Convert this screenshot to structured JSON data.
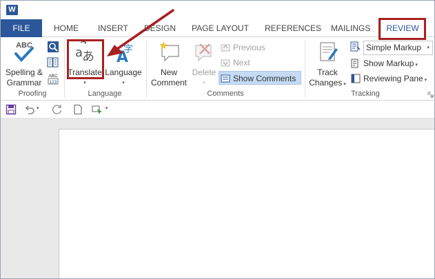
{
  "window": {
    "app_icon": "word-icon",
    "app_icon_letter": "W"
  },
  "tabs": {
    "file": "FILE",
    "home": "HOME",
    "insert": "INSERT",
    "design": "DESIGN",
    "page_layout": "PAGE LAYOUT",
    "references": "REFERENCES",
    "mailings": "MAILINGS",
    "review": "REVIEW"
  },
  "ribbon": {
    "proofing": {
      "label": "Proofing",
      "abc_icon_text": "ABC",
      "spelling_line1": "Spelling &",
      "spelling_line2": "Grammar",
      "wordcount_icon_text": "ABC\n123"
    },
    "language": {
      "label": "Language",
      "translate_label": "Translate",
      "translate_glyph": "aあ",
      "language_label": "Language",
      "language_glyph": "A字"
    },
    "comments": {
      "label": "Comments",
      "new_comment_line1": "New",
      "new_comment_line2": "Comment",
      "delete_label": "Delete",
      "previous_label": "Previous",
      "next_label": "Next",
      "show_comments_label": "Show Comments"
    },
    "tracking": {
      "label": "Tracking",
      "track_changes_line1": "Track",
      "track_changes_line2": "Changes",
      "markup_select_value": "Simple Markup",
      "show_markup_label": "Show Markup",
      "reviewing_pane_label": "Reviewing Pane"
    }
  },
  "colors": {
    "accent": "#2b579a",
    "highlight": "#a82020",
    "active_button": "#c5daf4"
  }
}
